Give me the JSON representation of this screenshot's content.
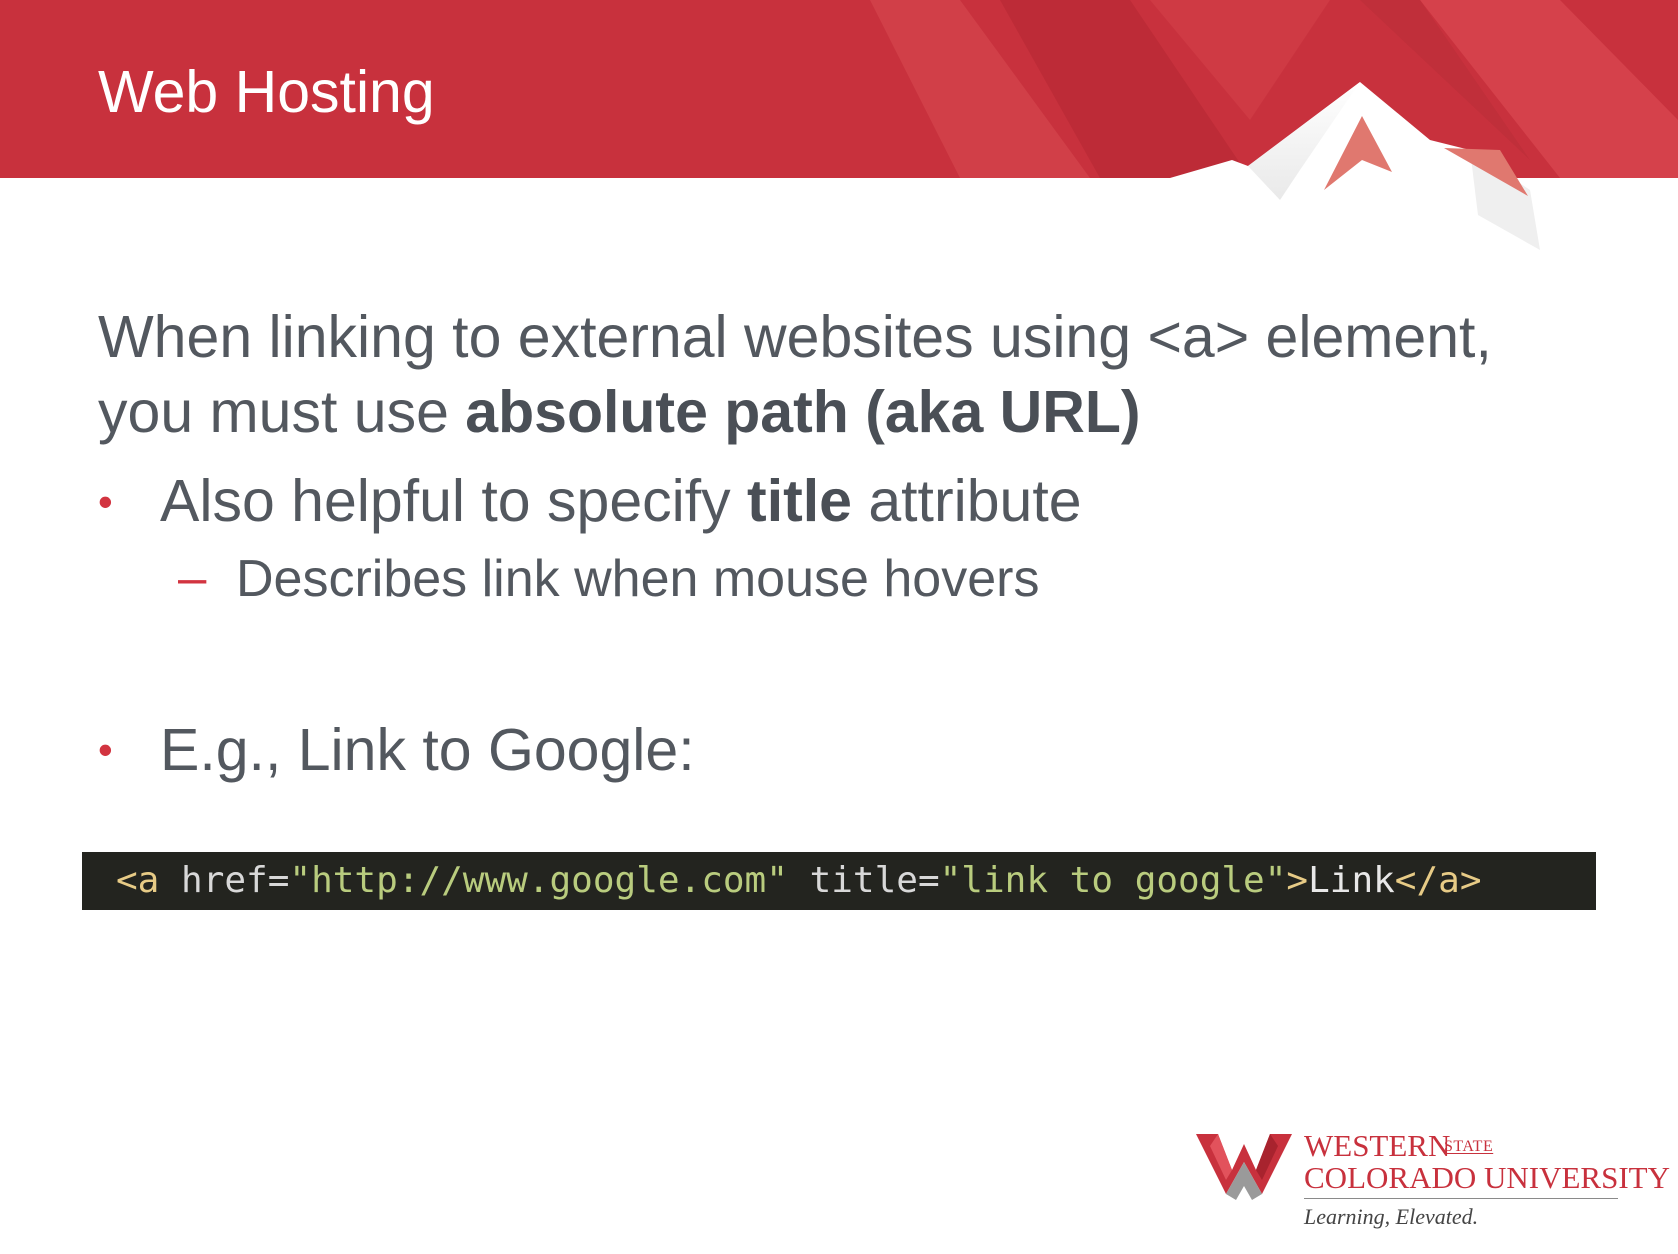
{
  "slide": {
    "title": "Web Hosting",
    "intro": {
      "line1": "When linking to external websites using <a> element,",
      "line2_prefix": "you must use ",
      "line2_bold": "absolute path (aka URL)"
    },
    "bullet1": {
      "marker": "•",
      "prefix": "Also helpful to specify ",
      "bold": "title",
      "suffix": " attribute"
    },
    "sub_bullet": {
      "marker": "–",
      "text": "Describes link when mouse hovers"
    },
    "bullet2": {
      "marker": "•",
      "text": "E.g., Link to Google:"
    },
    "code": {
      "open_tag": "<a",
      "href_attr": " href=",
      "href_value": "\"http://www.google.com\"",
      "title_attr": " title=",
      "title_value": "\"link to google\"",
      "close_bracket": ">",
      "link_text": "Link",
      "end_tag": "</a>"
    },
    "logo": {
      "line1": "WESTERN",
      "state": "STATE",
      "line2": "COLORADO UNIVERSITY",
      "tagline": "Learning, Elevated."
    }
  },
  "colors": {
    "banner_red": "#c8313d",
    "accent_red": "#d23440",
    "body_text": "#53585f",
    "code_bg": "#23241f"
  }
}
